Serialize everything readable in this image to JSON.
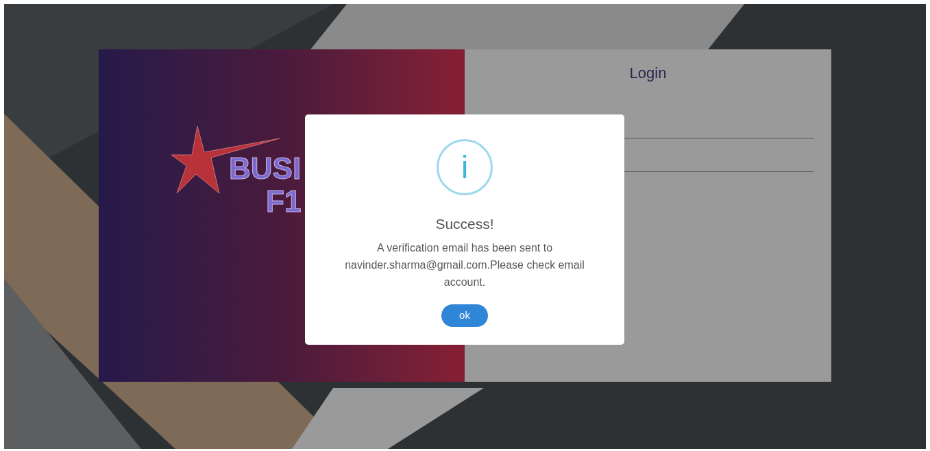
{
  "logo": {
    "word_1": "BUSI",
    "word_2": "F1"
  },
  "login": {
    "title": "Login",
    "fields": [
      {
        "kind": "line"
      },
      {
        "kind": "line"
      }
    ]
  },
  "dialog": {
    "icon": "i",
    "title": "Success!",
    "message": "A verification email has been sent to navinder.sharma@gmail.com.Please check email account.",
    "button": "ok"
  }
}
